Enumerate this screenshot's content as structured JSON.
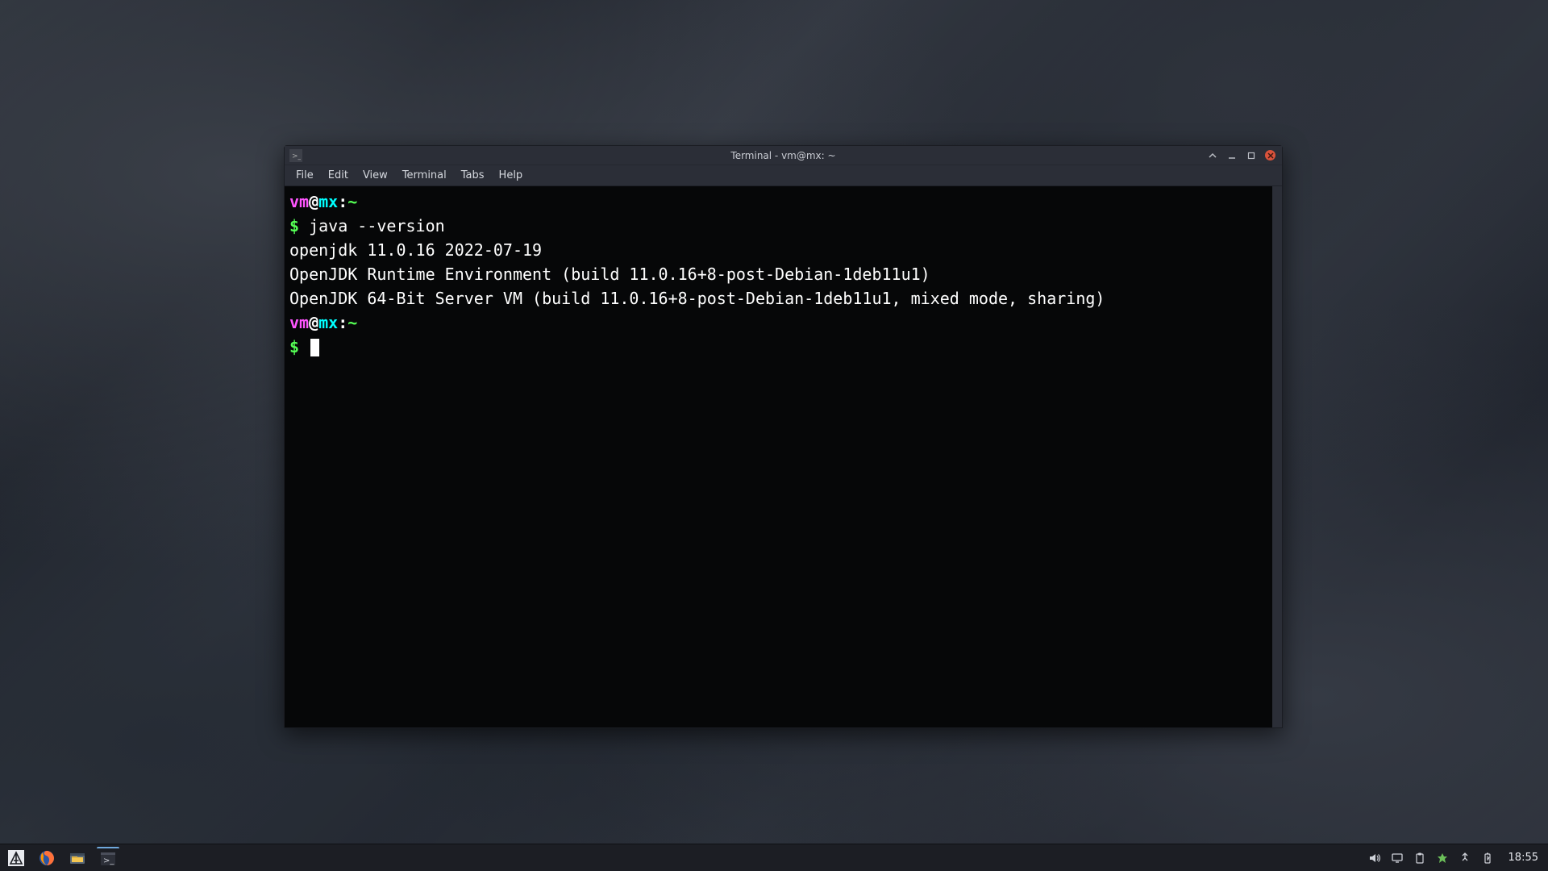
{
  "window": {
    "title": "Terminal - vm@mx: ~",
    "menus": [
      "File",
      "Edit",
      "View",
      "Terminal",
      "Tabs",
      "Help"
    ]
  },
  "terminal": {
    "prompt": {
      "user": "vm",
      "at": "@",
      "host": "mx",
      "colon": ":",
      "path": "~",
      "dollar": "$ "
    },
    "command1": "java --version",
    "output": [
      "openjdk 11.0.16 2022-07-19",
      "OpenJDK Runtime Environment (build 11.0.16+8-post-Debian-1deb11u1)",
      "OpenJDK 64-Bit Server VM (build 11.0.16+8-post-Debian-1deb11u1, mixed mode, sharing)"
    ]
  },
  "taskbar": {
    "clock": "18:55"
  }
}
